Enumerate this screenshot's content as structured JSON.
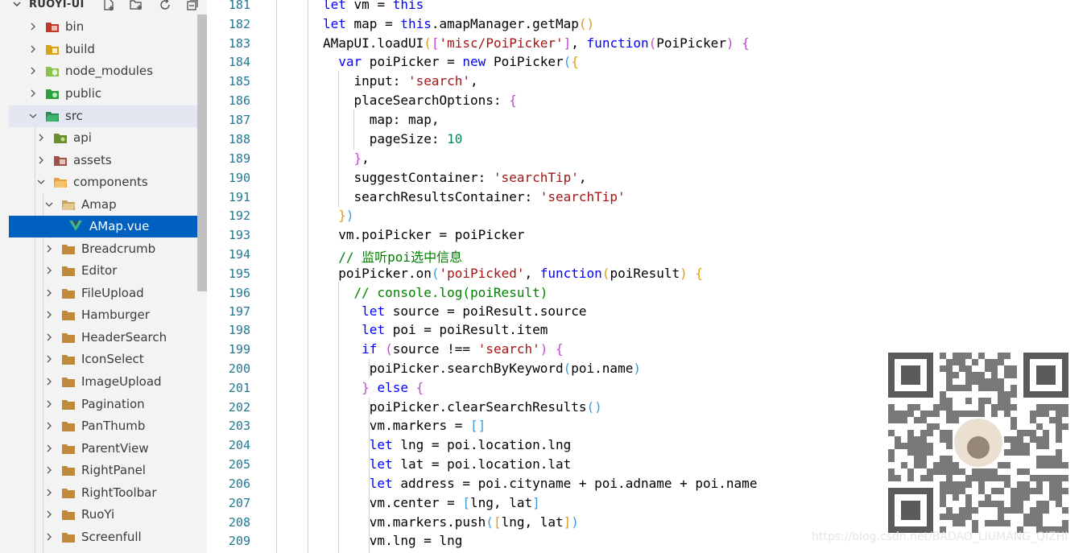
{
  "explorer": {
    "title": "RUOYI-UI",
    "actions": [
      "new-file-icon",
      "new-folder-icon",
      "refresh-icon",
      "collapse-all-icon"
    ],
    "items": [
      {
        "label": "bin",
        "icon": "bin-folder-icon",
        "expanded": false,
        "color": "#c0392b"
      },
      {
        "label": "build",
        "icon": "build-folder-icon",
        "expanded": false,
        "color": "#d9a21b"
      },
      {
        "label": "node_modules",
        "icon": "node-modules-folder-icon",
        "expanded": false,
        "color": "#8bc34a"
      },
      {
        "label": "public",
        "icon": "public-folder-icon",
        "expanded": false,
        "color": "#2e9e3e"
      },
      {
        "label": "src",
        "icon": "src-folder-icon",
        "expanded": true,
        "color": "#2e8b57"
      },
      {
        "label": "api",
        "icon": "api-folder-icon",
        "expanded": false,
        "color": "#6a8f2a"
      },
      {
        "label": "assets",
        "icon": "assets-folder-icon",
        "expanded": false,
        "color": "#a0524a"
      },
      {
        "label": "components",
        "icon": "components-folder-icon",
        "expanded": true,
        "color": "#e8a33c"
      },
      {
        "label": "Amap",
        "icon": "folder-open-icon",
        "expanded": true,
        "color": "#dcb67a"
      },
      {
        "label": "AMap.vue",
        "icon": "vue-file-icon",
        "selected": true,
        "color": "#41b883"
      },
      {
        "label": "Breadcrumb",
        "icon": "folder-icon",
        "expanded": false
      },
      {
        "label": "Editor",
        "icon": "folder-icon",
        "expanded": false
      },
      {
        "label": "FileUpload",
        "icon": "folder-icon",
        "expanded": false
      },
      {
        "label": "Hamburger",
        "icon": "folder-icon",
        "expanded": false
      },
      {
        "label": "HeaderSearch",
        "icon": "folder-icon",
        "expanded": false
      },
      {
        "label": "IconSelect",
        "icon": "folder-icon",
        "expanded": false
      },
      {
        "label": "ImageUpload",
        "icon": "folder-icon",
        "expanded": false
      },
      {
        "label": "Pagination",
        "icon": "folder-icon",
        "expanded": false
      },
      {
        "label": "PanThumb",
        "icon": "folder-icon",
        "expanded": false
      },
      {
        "label": "ParentView",
        "icon": "folder-icon",
        "expanded": false
      },
      {
        "label": "RightPanel",
        "icon": "folder-icon",
        "expanded": false
      },
      {
        "label": "RightToolbar",
        "icon": "folder-icon",
        "expanded": false
      },
      {
        "label": "RuoYi",
        "icon": "folder-icon",
        "expanded": false
      },
      {
        "label": "Screenfull",
        "icon": "folder-icon",
        "expanded": false
      }
    ]
  },
  "editor": {
    "lines": [
      {
        "n": "181",
        "code": "let vm = this"
      },
      {
        "n": "182",
        "code": "let map = this.amapManager.getMap()"
      },
      {
        "n": "183",
        "code": "AMapUI.loadUI(['misc/PoiPicker'], function(PoiPicker) {"
      },
      {
        "n": "184",
        "code": "  var poiPicker = new PoiPicker({"
      },
      {
        "n": "185",
        "code": "    input: 'search',"
      },
      {
        "n": "186",
        "code": "    placeSearchOptions: {"
      },
      {
        "n": "187",
        "code": "      map: map,"
      },
      {
        "n": "188",
        "code": "      pageSize: 10"
      },
      {
        "n": "189",
        "code": "    },"
      },
      {
        "n": "190",
        "code": "    suggestContainer: 'searchTip',"
      },
      {
        "n": "191",
        "code": "    searchResultsContainer: 'searchTip'"
      },
      {
        "n": "192",
        "code": "  })"
      },
      {
        "n": "193",
        "code": "  vm.poiPicker = poiPicker"
      },
      {
        "n": "194",
        "code": "  // 监听poi选中信息"
      },
      {
        "n": "195",
        "code": "  poiPicker.on('poiPicked', function(poiResult) {"
      },
      {
        "n": "196",
        "code": "    // console.log(poiResult)"
      },
      {
        "n": "197",
        "code": "     let source = poiResult.source"
      },
      {
        "n": "198",
        "code": "     let poi = poiResult.item"
      },
      {
        "n": "199",
        "code": "     if (source !== 'search') {"
      },
      {
        "n": "200",
        "code": "      poiPicker.searchByKeyword(poi.name)"
      },
      {
        "n": "201",
        "code": "     } else {"
      },
      {
        "n": "202",
        "code": "      poiPicker.clearSearchResults()"
      },
      {
        "n": "203",
        "code": "      vm.markers = []"
      },
      {
        "n": "204",
        "code": "      let lng = poi.location.lng"
      },
      {
        "n": "205",
        "code": "      let lat = poi.location.lat"
      },
      {
        "n": "206",
        "code": "      let address = poi.cityname + poi.adname + poi.name"
      },
      {
        "n": "207",
        "code": "      vm.center = [lng, lat]"
      },
      {
        "n": "208",
        "code": "      vm.markers.push([lng, lat])"
      },
      {
        "n": "209",
        "code": "      vm.lng = lng"
      }
    ]
  },
  "watermark": {
    "url": "https://blog.csdn.net/BADAO_LIUMANG_QIZHI",
    "qr_icon": "qr-code-icon"
  },
  "colors": {
    "keyword": "#0000ff",
    "string": "#a31515",
    "number": "#098658",
    "comment": "#008000",
    "line_number": "#237893",
    "selection": "#0060c0"
  }
}
